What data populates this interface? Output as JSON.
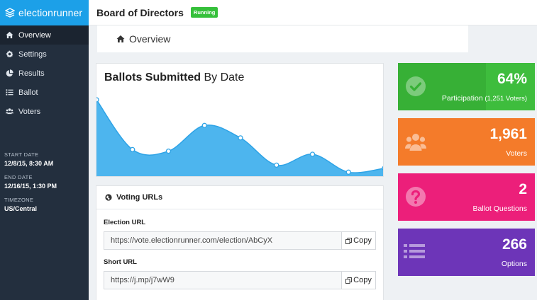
{
  "brand": {
    "name": "electionrunner"
  },
  "header": {
    "title": "Board of Directors",
    "status": "Running"
  },
  "sidebar": {
    "items": [
      {
        "label": "Overview",
        "icon": "home-icon",
        "active": true
      },
      {
        "label": "Settings",
        "icon": "gear-icon"
      },
      {
        "label": "Results",
        "icon": "pie-chart-icon"
      },
      {
        "label": "Ballot",
        "icon": "list-icon"
      },
      {
        "label": "Voters",
        "icon": "users-icon"
      }
    ],
    "start_date_label": "START DATE",
    "start_date": "12/8/15, 8:30 AM",
    "end_date_label": "END DATE",
    "end_date": "12/16/15, 1:30 PM",
    "timezone_label": "TIMEZONE",
    "timezone": "US/Central"
  },
  "breadcrumb": {
    "label": "Overview"
  },
  "chart": {
    "title_bold": "Ballots Submitted",
    "title_rest": " By Date"
  },
  "chart_data": {
    "type": "area",
    "title": "Ballots Submitted By Date",
    "xlabel": "",
    "ylabel": "",
    "x": [
      1,
      2,
      3,
      4,
      5,
      6,
      7,
      8,
      9
    ],
    "values": [
      100,
      36,
      34,
      67,
      51,
      16,
      30,
      7,
      12
    ],
    "ylim": [
      0,
      110
    ],
    "grid": false,
    "color": "#4db5ee",
    "line_color": "#2ea3e6"
  },
  "urls": {
    "heading": "Voting URLs",
    "election_label": "Election URL",
    "election_url": "https://vote.electionrunner.com/election/AbCyX",
    "short_label": "Short URL",
    "short_url": "https://j.mp/j7wW9",
    "copy_label": "Copy"
  },
  "stats": [
    {
      "value": "64%",
      "label": "Participation",
      "sublabel": " (1,251 Voters)",
      "icon": "check-circle-icon",
      "color": "#3ebd3d"
    },
    {
      "value": "1,961",
      "label": "Voters",
      "icon": "users-icon",
      "color": "#f47b2a"
    },
    {
      "value": "2",
      "label": "Ballot Questions",
      "icon": "question-circle-icon",
      "color": "#ec1f7a"
    },
    {
      "value": "266",
      "label": "Options",
      "icon": "list-icon",
      "color": "#6d35b8"
    }
  ]
}
